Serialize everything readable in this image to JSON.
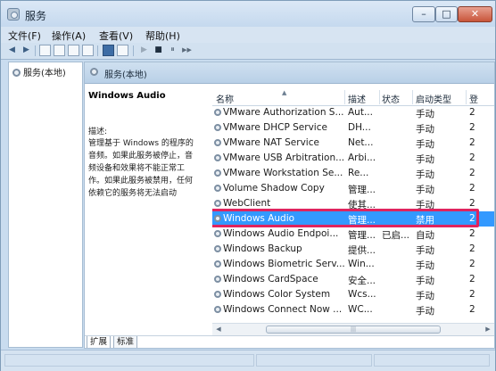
{
  "window": {
    "title": "服务"
  },
  "menu": [
    "文件(F)",
    "操作(A)",
    "查看(V)",
    "帮助(H)"
  ],
  "toolbar": {
    "back": "◀",
    "forward": "▶",
    "play": "▶",
    "stop": "■",
    "pause": "⏸",
    "restart": "▶▶"
  },
  "tree": {
    "root_label": "服务(本地)"
  },
  "main": {
    "header_label": "服务(本地)",
    "detail": {
      "title": "Windows Audio",
      "desc_label": "描述:",
      "desc_lines": [
        "管理基于 Windows 的程序的",
        "音频。如果此服务被停止，音",
        "频设备和效果将不能正常工",
        "作。如果此服务被禁用，任何",
        "依赖它的服务将无法启动"
      ]
    },
    "columns": {
      "name": "名称",
      "desc": "描述",
      "status": "状态",
      "start": "启动类型",
      "more": "登"
    },
    "rows": [
      {
        "name": "VMware Authorization S...",
        "desc": "Aut...",
        "status": "",
        "start": "手动",
        "more": "2"
      },
      {
        "name": "VMware DHCP Service",
        "desc": "DH...",
        "status": "",
        "start": "手动",
        "more": "2"
      },
      {
        "name": "VMware NAT Service",
        "desc": "Net...",
        "status": "",
        "start": "手动",
        "more": "2"
      },
      {
        "name": "VMware USB Arbitration...",
        "desc": "Arbi...",
        "status": "",
        "start": "手动",
        "more": "2"
      },
      {
        "name": "VMware Workstation Se...",
        "desc": "Re...",
        "status": "",
        "start": "手动",
        "more": "2"
      },
      {
        "name": "Volume Shadow Copy",
        "desc": "管理...",
        "status": "",
        "start": "手动",
        "more": "2"
      },
      {
        "name": "WebClient",
        "desc": "使其...",
        "status": "",
        "start": "手动",
        "more": "2"
      },
      {
        "name": "Windows Audio",
        "desc": "管理...",
        "status": "",
        "start": "禁用",
        "more": "2",
        "selected": true
      },
      {
        "name": "Windows Audio Endpoi...",
        "desc": "管理...",
        "status": "已启...",
        "start": "自动",
        "more": "2"
      },
      {
        "name": "Windows Backup",
        "desc": "提供...",
        "status": "",
        "start": "手动",
        "more": "2"
      },
      {
        "name": "Windows Biometric Serv...",
        "desc": "Win...",
        "status": "",
        "start": "手动",
        "more": "2"
      },
      {
        "name": "Windows CardSpace",
        "desc": "安全...",
        "status": "",
        "start": "手动",
        "more": "2"
      },
      {
        "name": "Windows Color System",
        "desc": "Wcs...",
        "status": "",
        "start": "手动",
        "more": "2"
      },
      {
        "name": "Windows Connect Now ...",
        "desc": "WC...",
        "status": "",
        "start": "手动",
        "more": "2"
      }
    ],
    "tabs": [
      "扩展",
      "标准"
    ]
  },
  "colors": {
    "selection": "#3399ff",
    "highlight_border": "#e0245e",
    "frame": "#c9dcef"
  },
  "icons": [
    "app-icon",
    "back-icon",
    "forward-icon",
    "service-gear-icon",
    "play-icon",
    "stop-icon",
    "pause-icon",
    "restart-icon",
    "sort-arrow-icon"
  ]
}
